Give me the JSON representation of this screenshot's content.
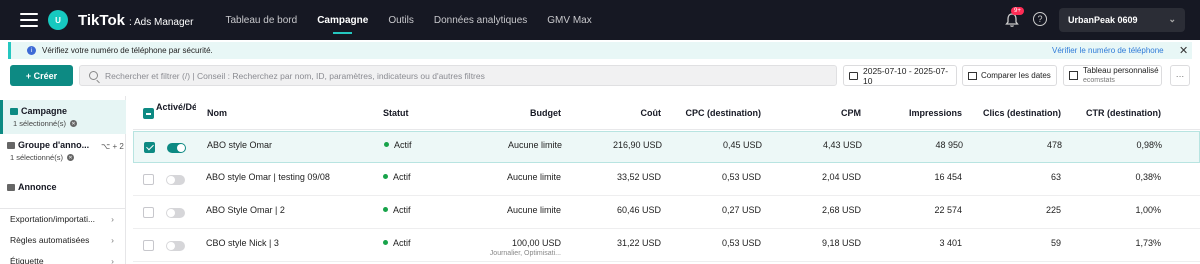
{
  "app": {
    "brand": "TikTok",
    "sub": ": Ads Manager",
    "avatar_letter": "U",
    "notification_count": "9+",
    "account_name": "UrbanPeak 0609"
  },
  "nav": [
    "Tableau de bord",
    "Campagne",
    "Outils",
    "Données analytiques",
    "GMV Max"
  ],
  "nav_active": "Campagne",
  "notice": {
    "text": "Vérifiez votre numéro de téléphone par sécurité.",
    "link": "Vérifier le numéro de téléphone"
  },
  "toolbar": {
    "create_label": "+ Créer",
    "search_placeholder": "Rechercher et filtrer (/) | Conseil : Recherchez par nom, ID, paramètres, indicateurs ou d'autres filtres",
    "date_range": "2025-07-10 - 2025-07-10",
    "compare_label": "Comparer les dates",
    "custom_table_title": "Tableau personnalisé",
    "custom_table_sub": "ecomstats",
    "more": "···"
  },
  "sidebar": {
    "campaign": {
      "label": "Campagne",
      "selected": "1 sélectionné(s)"
    },
    "group": {
      "label": "Groupe d'anno...",
      "selected": "1 sélectionné(s)",
      "extra": "⌥ + 2"
    },
    "ad": {
      "label": "Annonce"
    },
    "links": [
      "Exportation/importati...",
      "Règles automatisées",
      "Étiquette"
    ]
  },
  "table": {
    "headers": {
      "toggle": "Activé/Désactivé",
      "name": "Nom",
      "status": "Statut",
      "budget": "Budget",
      "cost": "Coût",
      "cpc": "CPC (destination)",
      "cpm": "CPM",
      "impressions": "Impressions",
      "clicks": "Clics (destination)",
      "ctr": "CTR (destination)"
    },
    "rows": [
      {
        "name": "ABO style Omar",
        "status": "Actif",
        "budget": "Aucune limite",
        "budget_sub": "",
        "cost": "216,90 USD",
        "cpc": "0,45 USD",
        "cpm": "4,43 USD",
        "impressions": "48 950",
        "clicks": "478",
        "ctr": "0,98%"
      },
      {
        "name": "ABO style Omar | testing 09/08",
        "status": "Actif",
        "budget": "Aucune limite",
        "budget_sub": "",
        "cost": "33,52 USD",
        "cpc": "0,53 USD",
        "cpm": "2,04 USD",
        "impressions": "16 454",
        "clicks": "63",
        "ctr": "0,38%"
      },
      {
        "name": "ABO Style Omar | 2",
        "status": "Actif",
        "budget": "Aucune limite",
        "budget_sub": "",
        "cost": "60,46 USD",
        "cpc": "0,27 USD",
        "cpm": "2,68 USD",
        "impressions": "22 574",
        "clicks": "225",
        "ctr": "1,00%"
      },
      {
        "name": "CBO style Nick | 3",
        "status": "Actif",
        "budget": "100,00 USD",
        "budget_sub": "Journalier, Optimisati...",
        "cost": "31,22 USD",
        "cpc": "0,53 USD",
        "cpm": "9,18 USD",
        "impressions": "3 401",
        "clicks": "59",
        "ctr": "1,73%"
      }
    ]
  },
  "colors": {
    "accent": "#0d8a83",
    "topbar": "#161823",
    "status_active": "#17a34a"
  }
}
